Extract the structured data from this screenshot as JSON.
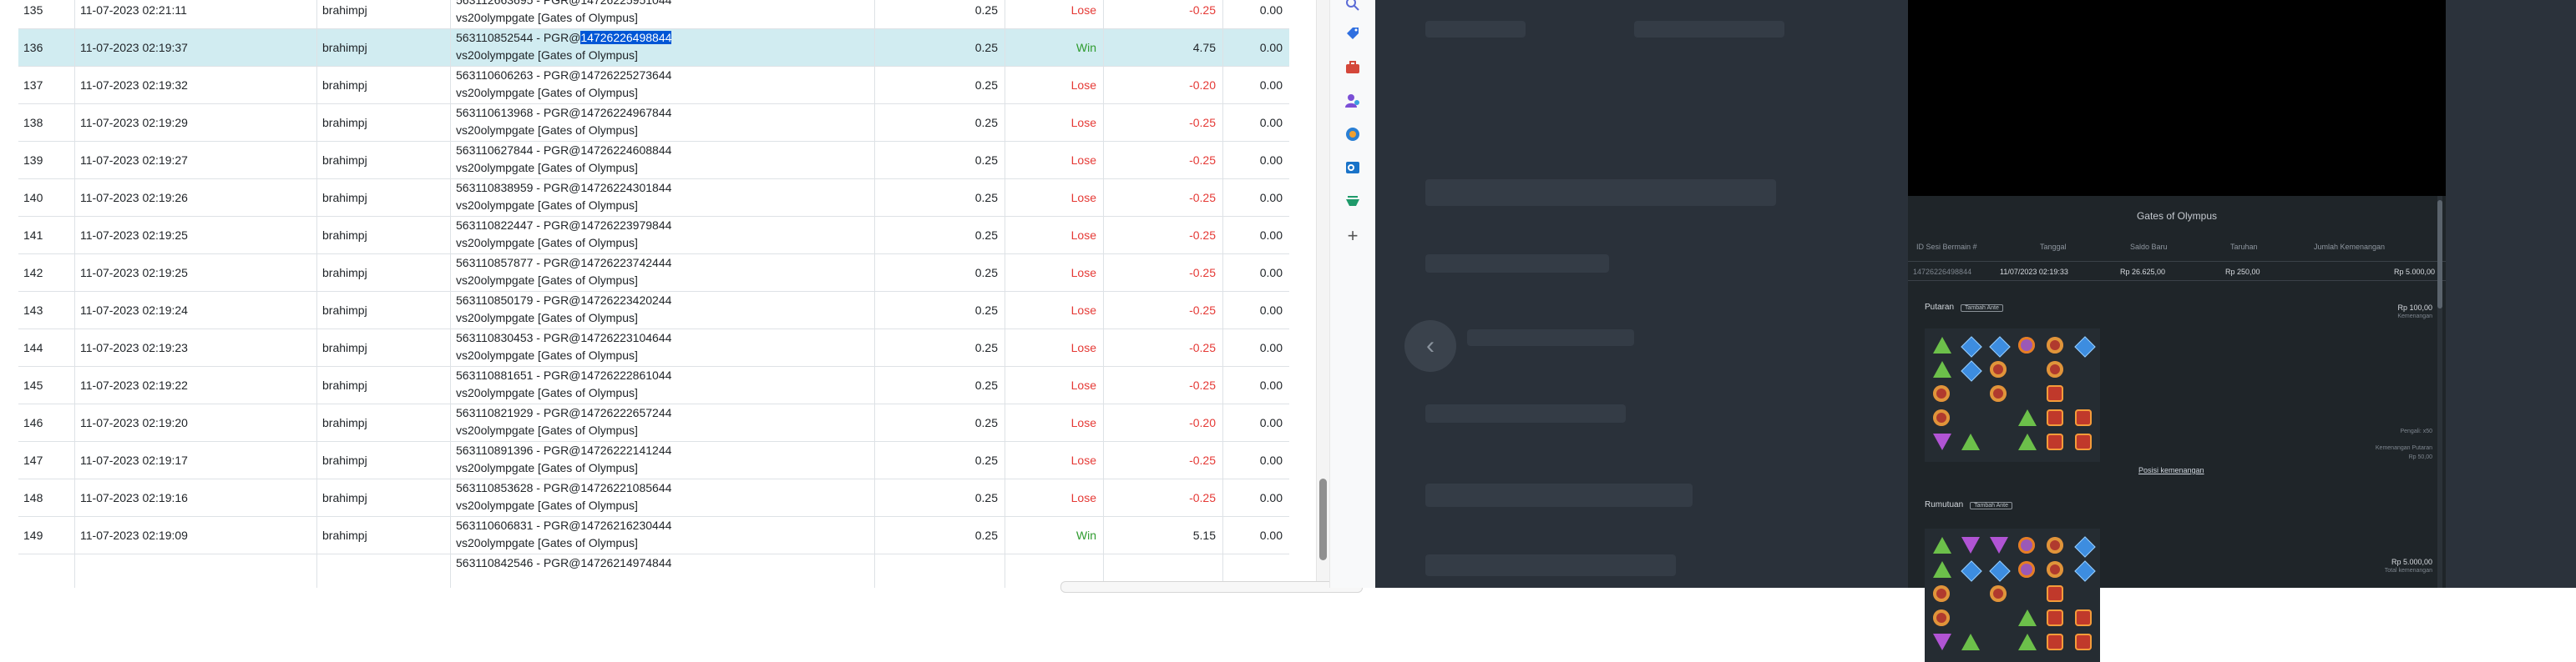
{
  "table": {
    "rows": [
      {
        "no": "135",
        "date": "11-07-2023 02:21:11",
        "user": "brahimpj",
        "desc_id": "563112663695 - PGR@14726225951044",
        "desc_game": "vs20olympgate [Gates of Olympus]",
        "bet": "0.25",
        "status": "Lose",
        "win": "-0.25",
        "balance": "0.00"
      },
      {
        "no": "136",
        "date": "11-07-2023 02:19:37",
        "user": "brahimpj",
        "desc_id_prefix": "563110852544 - PGR@",
        "desc_id_selected": "14726226498844",
        "desc_game": "vs20olympgate [Gates of Olympus]",
        "bet": "0.25",
        "status": "Win",
        "win": "4.75",
        "balance": "0.00"
      },
      {
        "no": "137",
        "date": "11-07-2023 02:19:32",
        "user": "brahimpj",
        "desc_id": "563110606263 - PGR@14726225273644",
        "desc_game": "vs20olympgate [Gates of Olympus]",
        "bet": "0.25",
        "status": "Lose",
        "win": "-0.20",
        "balance": "0.00"
      },
      {
        "no": "138",
        "date": "11-07-2023 02:19:29",
        "user": "brahimpj",
        "desc_id": "563110613968 - PGR@14726224967844",
        "desc_game": "vs20olympgate [Gates of Olympus]",
        "bet": "0.25",
        "status": "Lose",
        "win": "-0.25",
        "balance": "0.00"
      },
      {
        "no": "139",
        "date": "11-07-2023 02:19:27",
        "user": "brahimpj",
        "desc_id": "563110627844 - PGR@14726224608844",
        "desc_game": "vs20olympgate [Gates of Olympus]",
        "bet": "0.25",
        "status": "Lose",
        "win": "-0.25",
        "balance": "0.00"
      },
      {
        "no": "140",
        "date": "11-07-2023 02:19:26",
        "user": "brahimpj",
        "desc_id": "563110838959 - PGR@14726224301844",
        "desc_game": "vs20olympgate [Gates of Olympus]",
        "bet": "0.25",
        "status": "Lose",
        "win": "-0.25",
        "balance": "0.00"
      },
      {
        "no": "141",
        "date": "11-07-2023 02:19:25",
        "user": "brahimpj",
        "desc_id": "563110822447 - PGR@14726223979844",
        "desc_game": "vs20olympgate [Gates of Olympus]",
        "bet": "0.25",
        "status": "Lose",
        "win": "-0.25",
        "balance": "0.00"
      },
      {
        "no": "142",
        "date": "11-07-2023 02:19:25",
        "user": "brahimpj",
        "desc_id": "563110857877 - PGR@14726223742444",
        "desc_game": "vs20olympgate [Gates of Olympus]",
        "bet": "0.25",
        "status": "Lose",
        "win": "-0.25",
        "balance": "0.00"
      },
      {
        "no": "143",
        "date": "11-07-2023 02:19:24",
        "user": "brahimpj",
        "desc_id": "563110850179 - PGR@14726223420244",
        "desc_game": "vs20olympgate [Gates of Olympus]",
        "bet": "0.25",
        "status": "Lose",
        "win": "-0.25",
        "balance": "0.00"
      },
      {
        "no": "144",
        "date": "11-07-2023 02:19:23",
        "user": "brahimpj",
        "desc_id": "563110830453 - PGR@14726223104644",
        "desc_game": "vs20olympgate [Gates of Olympus]",
        "bet": "0.25",
        "status": "Lose",
        "win": "-0.25",
        "balance": "0.00"
      },
      {
        "no": "145",
        "date": "11-07-2023 02:19:22",
        "user": "brahimpj",
        "desc_id": "563110881651 - PGR@14726222861044",
        "desc_game": "vs20olympgate [Gates of Olympus]",
        "bet": "0.25",
        "status": "Lose",
        "win": "-0.25",
        "balance": "0.00"
      },
      {
        "no": "146",
        "date": "11-07-2023 02:19:20",
        "user": "brahimpj",
        "desc_id": "563110821929 - PGR@14726222657244",
        "desc_game": "vs20olympgate [Gates of Olympus]",
        "bet": "0.25",
        "status": "Lose",
        "win": "-0.20",
        "balance": "0.00"
      },
      {
        "no": "147",
        "date": "11-07-2023 02:19:17",
        "user": "brahimpj",
        "desc_id": "563110891396 - PGR@14726222141244",
        "desc_game": "vs20olympgate [Gates of Olympus]",
        "bet": "0.25",
        "status": "Lose",
        "win": "-0.25",
        "balance": "0.00"
      },
      {
        "no": "148",
        "date": "11-07-2023 02:19:16",
        "user": "brahimpj",
        "desc_id": "563110853628 - PGR@14726221085644",
        "desc_game": "vs20olympgate [Gates of Olympus]",
        "bet": "0.25",
        "status": "Lose",
        "win": "-0.25",
        "balance": "0.00"
      },
      {
        "no": "149",
        "date": "11-07-2023 02:19:09",
        "user": "brahimpj",
        "desc_id": "563110606831 - PGR@14726216230444",
        "desc_game": "vs20olympgate [Gates of Olympus]",
        "bet": "0.25",
        "status": "Win",
        "win": "5.15",
        "balance": "0.00"
      },
      {
        "no": "",
        "date": "",
        "user": "",
        "desc_id": "563110842546 - PGR@14726214974844",
        "desc_game": "",
        "bet": "",
        "status": "",
        "win": "",
        "balance": ""
      }
    ]
  },
  "sidebar": {
    "icons": [
      "search-icon",
      "tag-icon",
      "briefcase-icon",
      "person-icon",
      "office-icon",
      "outlook-icon",
      "chart-icon",
      "add-icon"
    ],
    "add_glyph": "+"
  },
  "game_panel": {
    "title": "Gates of Olympus",
    "headers": [
      "ID Sesi Bermain #",
      "Tanggal",
      "Saldo Baru",
      "Taruhan",
      "Jumlah Kemenangan"
    ],
    "row": {
      "session_id": "14726226498844",
      "date": "11/07/2023 02:19:33",
      "balance": "Rp 26.625,00",
      "bet": "Rp 250,00",
      "win": "Rp 5.000,00"
    },
    "section1": {
      "title": "Putaran",
      "tag": "Tambah Ante",
      "amount": "Rp 100,00",
      "amount_label": "Kemenangan",
      "multiplier_label": "Pengali: x50",
      "win_label": "Kemenangan Putaran",
      "win_value": "Rp 50,00",
      "link": "Posisi kemenangan"
    },
    "section2": {
      "title": "Rumutuan",
      "tag": "Tambah Ante",
      "amount": "Rp 5.000,00",
      "amount_label": "Total kemenangan"
    }
  },
  "colors": {
    "lose": "#e53935",
    "win": "#2e9b2e",
    "selected_row": "#d1ecf1",
    "selection": "#0056d6"
  }
}
